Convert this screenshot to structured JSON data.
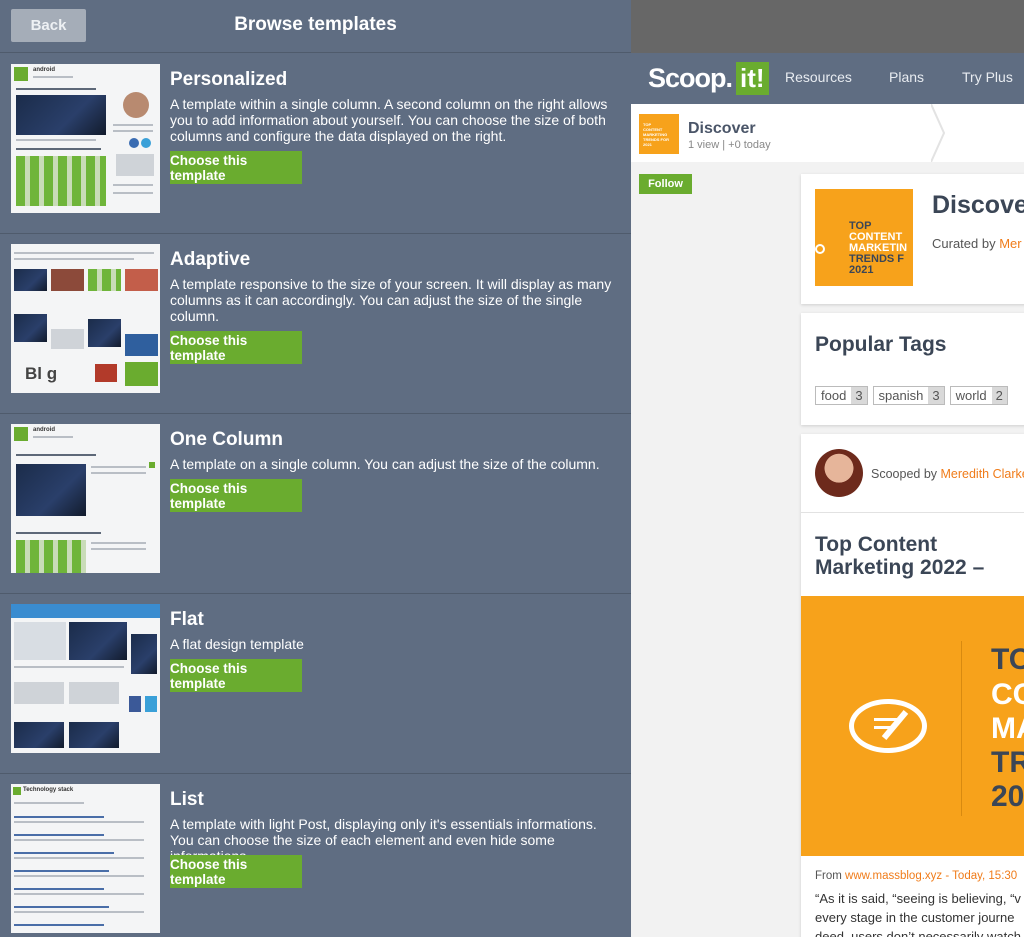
{
  "left_panel": {
    "back_label": "Back",
    "title": "Browse templates",
    "templates": [
      {
        "name": "Personalized",
        "description": "A template within a single column. A second column on the right allows you to add information about yourself. You can choose the size of both columns and configure the data displayed on the right.",
        "button": "Choose this template"
      },
      {
        "name": "Adaptive",
        "description": "A template responsive to the size of your screen. It will display as many columns as it can accordingly. You can adjust the size of the single column.",
        "button": "Choose this template"
      },
      {
        "name": "One Column",
        "description": "A template on a single column. You can adjust the size of the column.",
        "button": "Choose this template"
      },
      {
        "name": "Flat",
        "description": "A flat design template",
        "button": "Choose this template"
      },
      {
        "name": "List",
        "description": "A template with light Post, displaying only it's essentials informations. You can choose the size of each element and even hide some informations.",
        "button": "Choose this template"
      }
    ],
    "thumbnail_text": {
      "android": "android",
      "blog": "Bl g",
      "list_title": "Technology stack"
    }
  },
  "right_panel": {
    "logo": {
      "scoop": "Scoop",
      "dot": ".",
      "it": "it!"
    },
    "nav": [
      "Resources",
      "Plans",
      "Try Plus"
    ],
    "topic": {
      "thumb_text": "TOP CONTENT MARKETING TRENDS FOR 2021",
      "title": "Discover",
      "stats": "1 view | +0 today"
    },
    "follow_label": "Follow",
    "header_card": {
      "thumb_lines": [
        "TOP",
        "CONTENT",
        "MARKETIN",
        "TRENDS F",
        "2021"
      ],
      "title": "Discover",
      "curated_prefix": "Curated by ",
      "curator": "Mer"
    },
    "popular_tags": {
      "title": "Popular Tags",
      "tags": [
        {
          "name": "food",
          "count": "3"
        },
        {
          "name": "spanish",
          "count": "3"
        },
        {
          "name": "world",
          "count": "2"
        }
      ]
    },
    "post": {
      "scooped_prefix": "Scooped by ",
      "author": "Meredith Clarke",
      "title": "Top Content Marketing 2022 –",
      "image_lines": [
        "TO",
        "CO",
        "MA",
        "TR",
        "20"
      ],
      "from_prefix": "From ",
      "source": "www.massblog.xyz - Today, 15:30",
      "text_lines": [
        "“As it is said, “seeing is believing, “v",
        "every stage in the customer journe",
        "deed, users don’t necessarily watch"
      ]
    }
  },
  "colors": {
    "panel": "#5f6d82",
    "accent_green": "#6aac2f",
    "orange": "#f7a21b",
    "link_orange": "#f07c1a"
  }
}
